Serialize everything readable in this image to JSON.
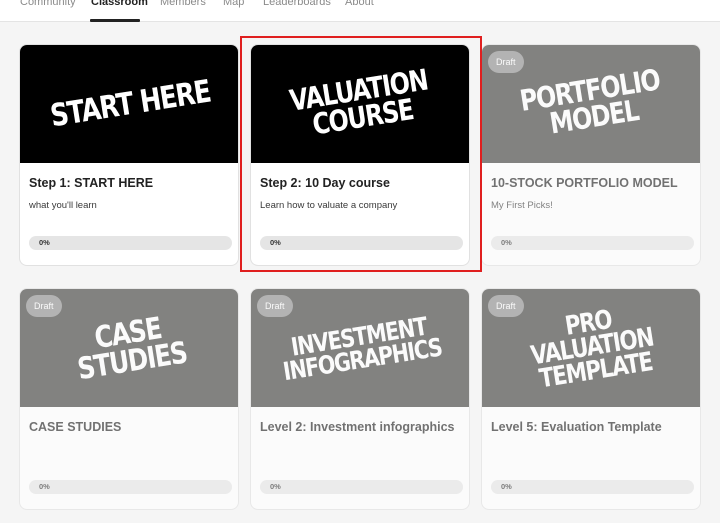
{
  "nav": {
    "tabs": [
      {
        "label": "Community",
        "active": false
      },
      {
        "label": "Classroom",
        "active": true
      },
      {
        "label": "Members",
        "active": false
      },
      {
        "label": "Map",
        "active": false
      },
      {
        "label": "Leaderboards",
        "active": false
      },
      {
        "label": "About",
        "active": false
      }
    ]
  },
  "courses": [
    {
      "cover_text": "START HERE",
      "cover_color": "#000000",
      "draft": "",
      "title": "Step 1: START HERE",
      "description": "what you'll learn",
      "progress": "0%"
    },
    {
      "cover_text": "VALUATION\nCOURSE",
      "cover_color": "#000000",
      "draft": "",
      "title": "Step 2: 10 Day course",
      "description": "Learn how to valuate a company",
      "progress": "0%"
    },
    {
      "cover_text": "PORTFOLIO\nMODEL",
      "cover_color": "#3d3d3a",
      "draft": "Draft",
      "title": "10-STOCK PORTFOLIO MODEL",
      "description": "My First Picks!",
      "progress": "0%"
    },
    {
      "cover_text": "CASE STUDIES",
      "cover_color": "#3d3d3a",
      "draft": "Draft",
      "title": "CASE STUDIES",
      "description": "",
      "progress": "0%"
    },
    {
      "cover_text": "INVESTMENT\nINFOGRAPHICS",
      "cover_color": "#3d3d3a",
      "draft": "Draft",
      "title": "Level 2: Investment infographics",
      "description": "",
      "progress": "0%"
    },
    {
      "cover_text": "PRO\nVALUATION\nTEMPLATE",
      "cover_color": "#3d3d3a",
      "draft": "Draft",
      "title": "Level 5: Evaluation Template",
      "description": "",
      "progress": "0%"
    }
  ],
  "progress_fraction": [
    0,
    0,
    0,
    0,
    0,
    0
  ]
}
